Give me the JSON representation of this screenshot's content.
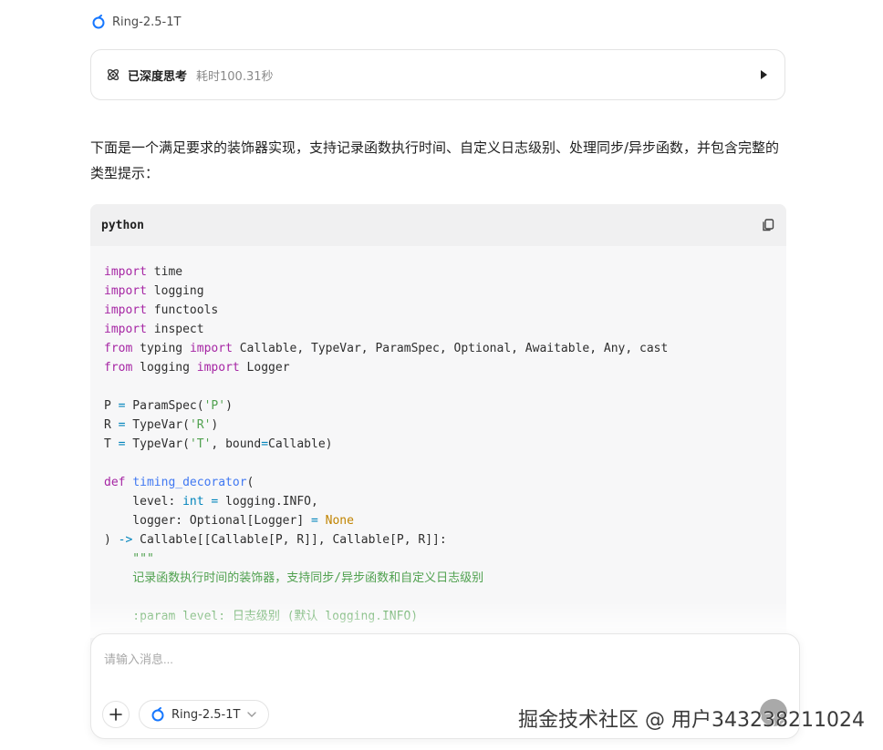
{
  "model": {
    "name": "Ring-2.5-1T"
  },
  "thinking": {
    "title": "已深度思考",
    "time": "耗时100.31秒"
  },
  "intro": "下面是一个满足要求的装饰器实现，支持记录函数执行时间、自定义日志级别、处理同步/异步函数，并包含完整的类型提示：",
  "code": {
    "language": "python",
    "lines": [
      "import time",
      "import logging",
      "import functools",
      "import inspect",
      "from typing import Callable, TypeVar, ParamSpec, Optional, Awaitable, Any, cast",
      "from logging import Logger",
      "",
      "P = ParamSpec('P')",
      "R = TypeVar('R')",
      "T = TypeVar('T', bound=Callable)",
      "",
      "def timing_decorator(",
      "    level: int = logging.INFO,",
      "    logger: Optional[Logger] = None",
      ") -> Callable[[Callable[P, R]], Callable[P, R]]:",
      "    \"\"\"",
      "    记录函数执行时间的装饰器，支持同步/异步函数和自定义日志级别",
      "",
      "    :param level: 日志级别 (默认 logging.INFO)"
    ]
  },
  "input": {
    "placeholder": "请输入消息..."
  },
  "watermark": "掘金技术社区 @ 用户343238211024",
  "icons": {
    "model": "ring-logo-icon",
    "thinking": "atom-icon",
    "toggle": "caret-right-icon",
    "copy": "copy-icon",
    "add": "plus-icon",
    "select": "chevron-down-icon"
  },
  "colors": {
    "accent": "#1677ff",
    "keyword": "#a626a4",
    "string": "#50a14f",
    "function": "#4078f2"
  }
}
